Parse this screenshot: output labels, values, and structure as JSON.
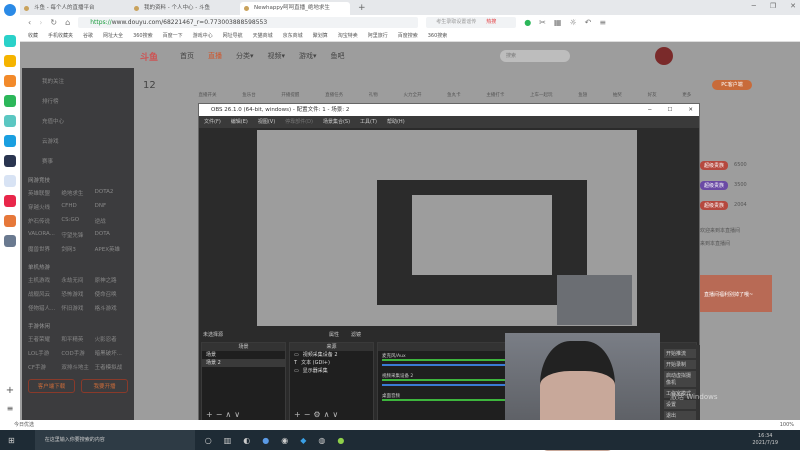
{
  "browser": {
    "tabs": [
      {
        "label": "斗鱼 - 每个人的直播平台"
      },
      {
        "label": "我的资料 - 个人中心 - 斗鱼"
      },
      {
        "label": "Newhappy呵呵直播_绝地求生"
      }
    ],
    "new_tab": "+",
    "url_scheme": "https://",
    "url_rest": "www.douyu.com/68221467_r=0.773003888598553",
    "search_placeholder": "考生录取设置谣传",
    "search_hot": "热搜",
    "bookmarks": [
      "收藏",
      "手机收藏夹",
      "谷歌",
      "网址大全",
      "360搜索",
      "百度一下",
      "游戏中心",
      "网址导航",
      "天猫商城",
      "京东商城",
      "聚划算",
      "淘宝特卖",
      "阿里旅行",
      "百度搜索",
      "360搜索"
    ]
  },
  "douyu": {
    "logo": "斗鱼",
    "nav": [
      "首页",
      "直播",
      "分类▾",
      "视频▾",
      "游戏▾",
      "鱼吧"
    ],
    "search_placeholder": "搜索",
    "count": "12",
    "icons": [
      "直播开关",
      "鱼乐台",
      "开播提醒",
      "直播任务",
      "礼物",
      "火力全开",
      "鱼丸卡",
      "主播打卡",
      "上车一起玩",
      "鱼翅",
      "抽奖",
      "好友",
      "更多"
    ],
    "pc_client": "PC客户端",
    "menu": {
      "items": [
        "我的关注",
        "排行榜",
        "充值中心",
        "云游戏",
        "赛事"
      ],
      "sections": [
        {
          "title": "网游竞技",
          "games": [
            "英雄联盟",
            "绝地求生",
            "DOTA2",
            "穿越火线",
            "CFHD",
            "DNF",
            "炉石传说",
            "CS:GO",
            "逆战",
            "VALORA...",
            "守望先锋",
            "DOTA",
            "魔兽世界",
            "剑网3",
            "APEX英雄"
          ]
        },
        {
          "title": "单机热游",
          "games": [
            "主机游戏",
            "永劫无间",
            "原神之路",
            "战舰风云",
            "恐怖游戏",
            "使命召唤",
            "怪物猎人...",
            "怀旧游戏",
            "格斗游戏"
          ]
        },
        {
          "title": "手游休闲",
          "games": [
            "王者荣耀",
            "和平精英",
            "火影忍者",
            "LOL手游",
            "COD手游",
            "暗黑破坏...",
            "CF手游",
            "双排斗地主",
            "王者模拟战"
          ]
        }
      ],
      "buttons": [
        "客户端下载",
        "我要开播"
      ]
    },
    "ranks": [
      {
        "badge": "超级贵族",
        "value": "6500"
      },
      {
        "badge": "超级贵族",
        "value": "3500"
      },
      {
        "badge": "超级贵族",
        "value": "2004"
      }
    ],
    "chat": [
      "欢迎来到本直播间",
      "来到本直播间"
    ],
    "promo": "直播间福利别掉了哦~",
    "status_left": "今日优选",
    "zoom": "100%"
  },
  "obs": {
    "title": "OBS 26.1.0 (64-bit, windows) - 配置文件: 1 - 场景: 2",
    "menu": [
      "文件(F)",
      "编辑(E)",
      "视图(V)",
      "停靠部件(D)",
      "场景集合(S)",
      "工具(T)",
      "帮助(H)"
    ],
    "no_source": "未选择源",
    "properties": "属性",
    "filters": "滤镜",
    "scenes_header": "场景",
    "scenes": [
      "场景",
      "场景 2"
    ],
    "sources_header": "来源",
    "sources": [
      "视频采集设备 2",
      "文本 (GDI+)",
      "显示器采集"
    ],
    "mixer_header": "混音器",
    "mixer": [
      "麦克风/Aux",
      "视频采集设备 2",
      "桌面音频"
    ],
    "controls_side": [
      "开始推流",
      "开始录制",
      "启动虚拟摄像机",
      "工作室模式",
      "设置",
      "退出"
    ]
  },
  "watermark": "激活 Windows",
  "taskbar": {
    "search": "在这里输入你要搜索的内容",
    "time": "16:34",
    "date": "2021/7/19"
  }
}
